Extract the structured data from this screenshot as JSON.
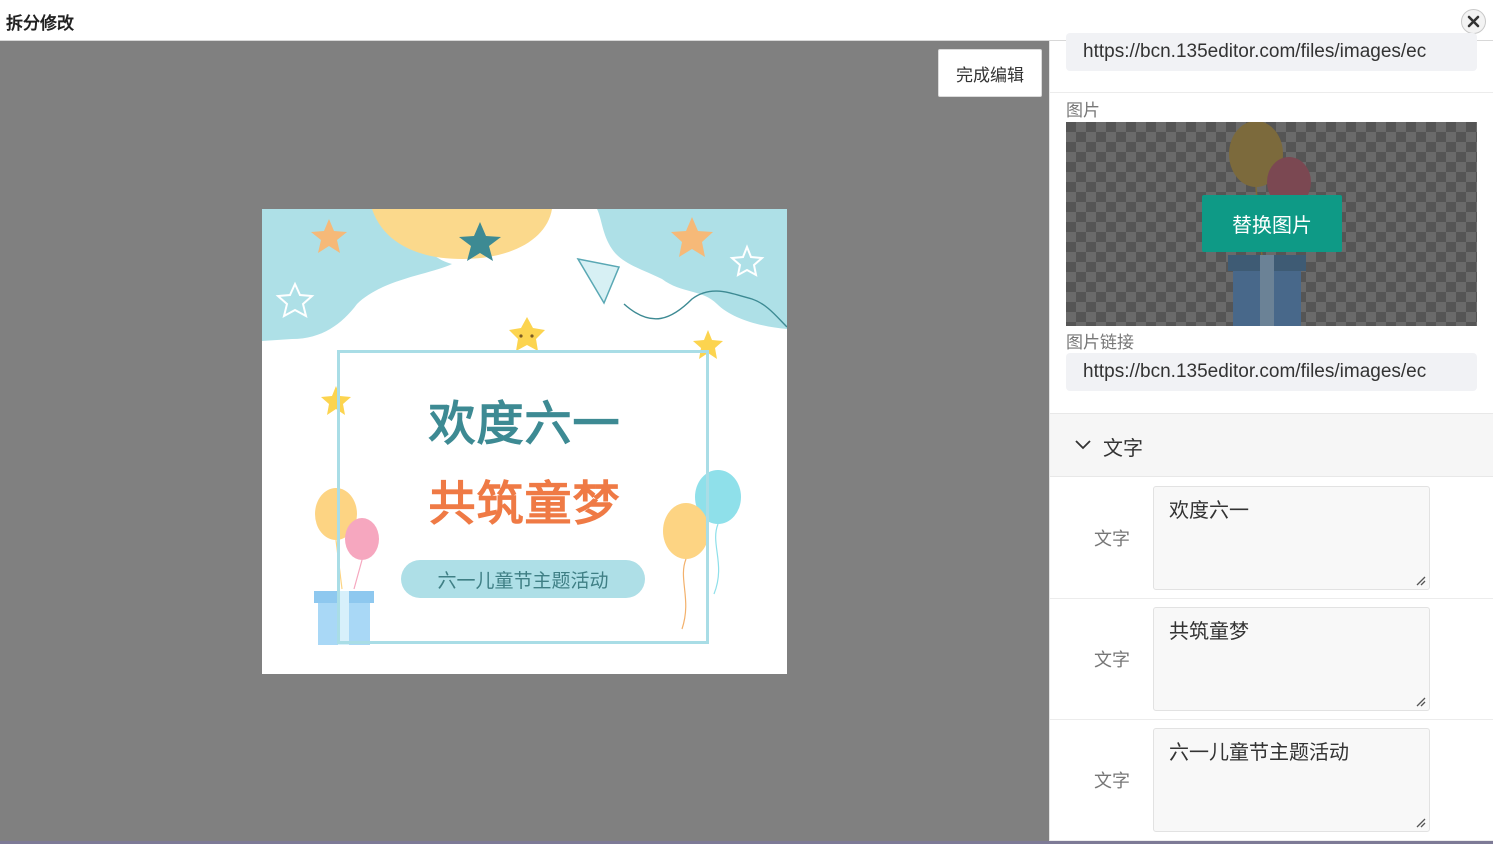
{
  "window": {
    "title": "拆分修改"
  },
  "toolbar": {
    "done_label": "完成编辑"
  },
  "poster": {
    "title_line1": "欢度六一",
    "title_line2": "共筑童梦",
    "subtitle": "六一儿童节主题活动",
    "colors": {
      "title1": "#3d8a93",
      "title2": "#ef7a45",
      "pill": "#aedfe7"
    }
  },
  "panel": {
    "top_url": "https://bcn.135editor.com/files/images/ec",
    "image_label": "图片",
    "replace_label": "替换图片",
    "image_link_label": "图片链接",
    "image_link_value": "https://bcn.135editor.com/files/images/ec",
    "text_section_label": "文字",
    "text_fields": [
      {
        "label": "文字",
        "value": "欢度六一"
      },
      {
        "label": "文字",
        "value": "共筑童梦"
      },
      {
        "label": "文字",
        "value": "六一儿童节主题活动"
      }
    ],
    "colors": {
      "accent": "#0e9a86"
    }
  },
  "icons": {
    "close": "close-icon",
    "chevron": "chevron-down-icon",
    "resize": "resize-grip-icon"
  }
}
